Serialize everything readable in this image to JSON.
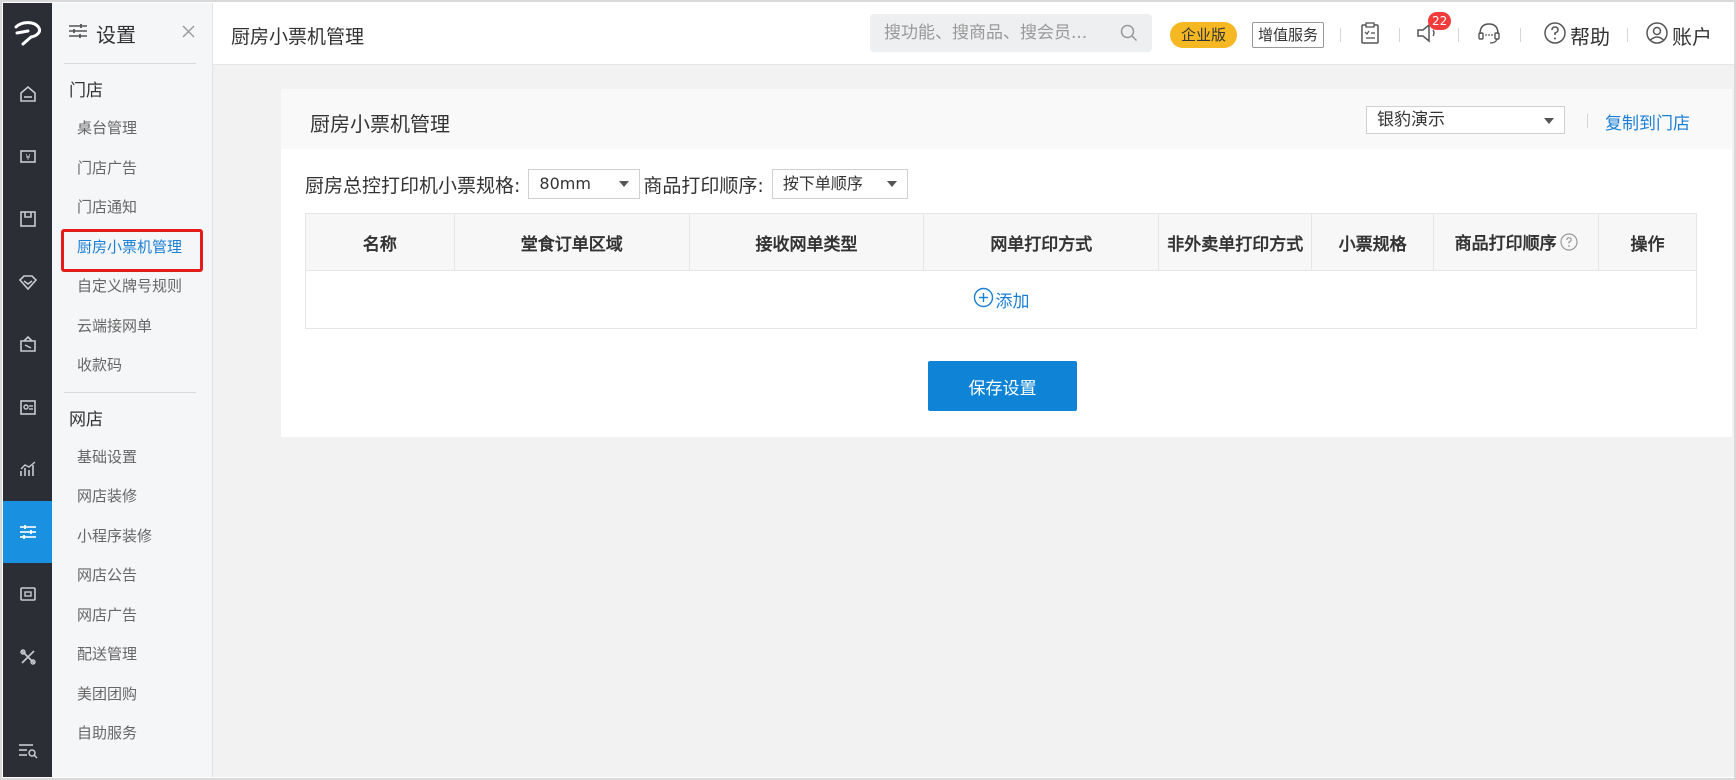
{
  "sidebar": {
    "title": "设置",
    "sections": [
      {
        "title": "门店",
        "items": [
          "桌台管理",
          "门店广告",
          "门店通知",
          "厨房小票机管理",
          "自定义牌号规则",
          "云端接网单",
          "收款码"
        ]
      },
      {
        "title": "网店",
        "items": [
          "基础设置",
          "网店装修",
          "小程序装修",
          "网店公告",
          "网店广告",
          "配送管理",
          "美团团购",
          "自助服务"
        ]
      }
    ],
    "active_item": "厨房小票机管理"
  },
  "header": {
    "page_title": "厨房小票机管理",
    "search_placeholder": "搜功能、搜商品、搜会员...",
    "edition_badge": "企业版",
    "value_added_label": "增值服务",
    "notification_count": "22",
    "help_label": "帮助",
    "account_label": "账户"
  },
  "card": {
    "title": "厨房小票机管理",
    "store_select_value": "银豹演示",
    "copy_link": "复制到门店"
  },
  "form": {
    "spec_label": "厨房总控打印机小票规格:",
    "spec_value": "80mm",
    "order_label": "商品打印顺序:",
    "order_value": "按下单顺序"
  },
  "table": {
    "columns": [
      "名称",
      "堂食订单区域",
      "接收网单类型",
      "网单打印方式",
      "非外卖单打印方式",
      "小票规格",
      "商品打印顺序",
      "操作"
    ],
    "add_label": "添加"
  },
  "save_button": "保存设置",
  "colors": {
    "rail_bg": "#2b2f35",
    "rail_active": "#1a90e0",
    "accent": "#1a7fd6",
    "primary_button": "#0f84d6",
    "badge": "#f5b822",
    "highlight_box": "#e51c1c"
  }
}
